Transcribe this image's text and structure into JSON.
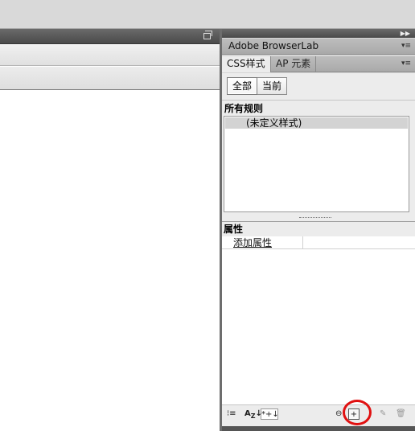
{
  "browserlab_panel": {
    "tab_label": "Adobe BrowserLab"
  },
  "css_panel": {
    "tabs": [
      {
        "label": "CSS样式",
        "active": true
      },
      {
        "label": "AP 元素",
        "active": false
      }
    ],
    "mode_buttons": [
      {
        "label": "全部",
        "active": true
      },
      {
        "label": "当前",
        "active": false
      }
    ],
    "rules_header": "所有规则",
    "rules": [
      "(未定义样式)"
    ],
    "properties_header": "属性",
    "add_property_link": "添加属性",
    "footer_icons": [
      "category-view-icon",
      "az-sort-icon",
      "set-properties-icon",
      "attach-stylesheet-icon",
      "new-css-rule-icon",
      "edit-style-icon",
      "delete-icon"
    ]
  },
  "colors": {
    "highlight_circle": "#e01010",
    "selected_rule_bg": "#d3d3d3"
  }
}
